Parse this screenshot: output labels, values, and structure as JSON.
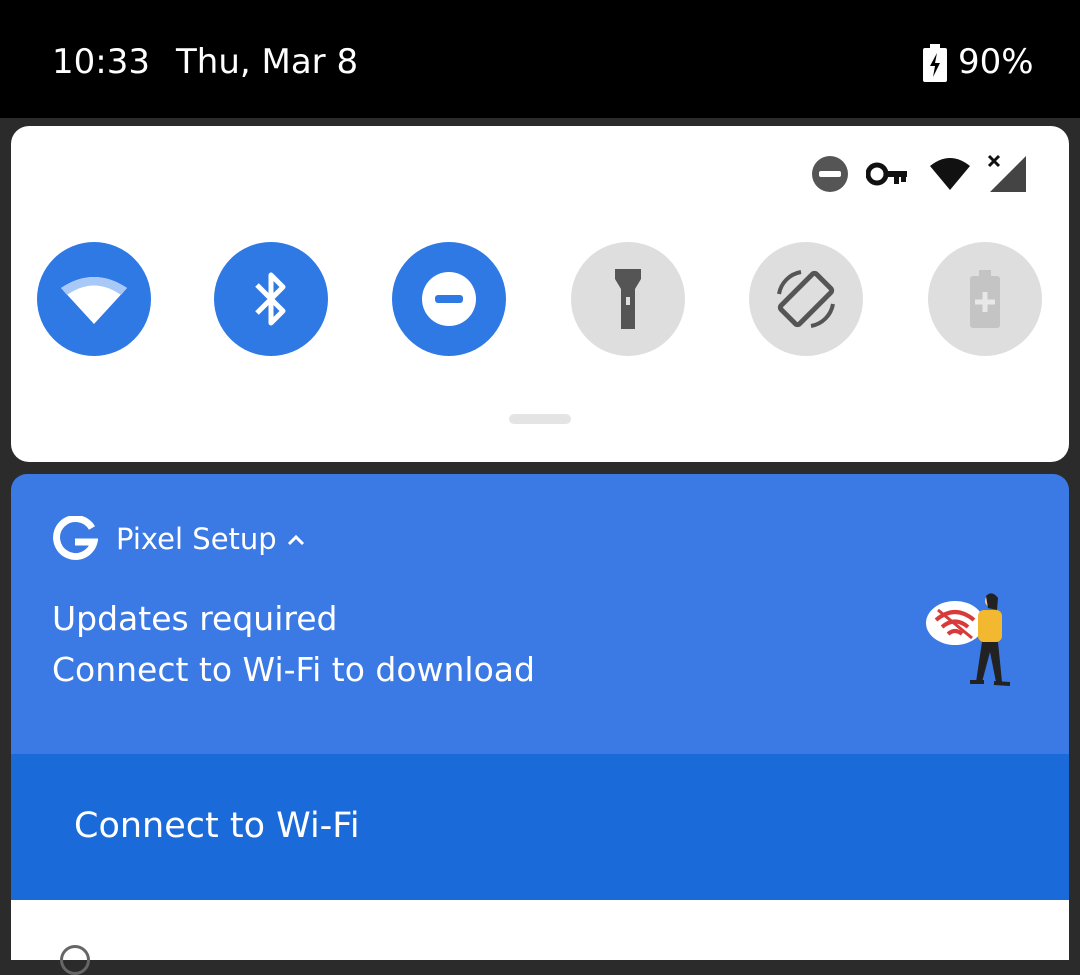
{
  "status_bar": {
    "time": "10:33",
    "date": "Thu, Mar 8",
    "battery_percent": "90%",
    "battery_icon": "battery-charging-icon"
  },
  "quick_settings": {
    "status_icons": [
      "do-not-disturb-icon",
      "vpn-key-icon",
      "wifi-icon",
      "cellular-no-signal-icon"
    ],
    "tiles": [
      {
        "name": "wifi",
        "icon": "wifi-icon",
        "active": true
      },
      {
        "name": "bluetooth",
        "icon": "bluetooth-icon",
        "active": true
      },
      {
        "name": "do-not-disturb",
        "icon": "do-not-disturb-icon",
        "active": true
      },
      {
        "name": "flashlight",
        "icon": "flashlight-icon",
        "active": false
      },
      {
        "name": "auto-rotate",
        "icon": "screen-rotation-icon",
        "active": false
      },
      {
        "name": "battery-saver",
        "icon": "battery-saver-icon",
        "active": false
      }
    ],
    "accent_color": "#2f79e4",
    "inactive_color": "#dedede"
  },
  "notification": {
    "app_name": "Pixel Setup",
    "app_icon": "google-g-icon",
    "title": "Updates required",
    "text": "Connect to Wi-Fi to download",
    "action_label": "Connect to Wi-Fi",
    "background_color": "#3b79e4",
    "action_bar_color": "#1a6ad9"
  }
}
